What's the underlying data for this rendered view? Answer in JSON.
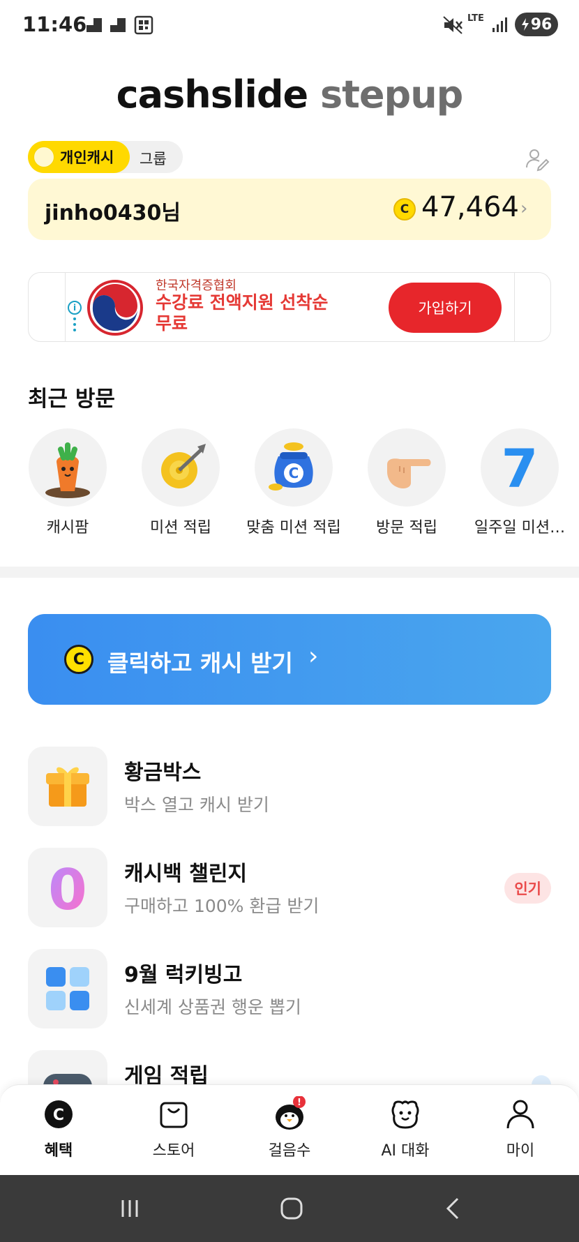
{
  "status_bar": {
    "time": "11:46",
    "battery": "96",
    "network": "LTE"
  },
  "logo": {
    "part1": "cashslide",
    "part2": "stepup"
  },
  "toggle": {
    "active_label": "개인캐시",
    "inactive_label": "그룹"
  },
  "cash_card": {
    "username": "jinho0430님",
    "coin_symbol": "C",
    "balance": "47,464"
  },
  "ad": {
    "org": "한국자격증협회",
    "headline": "수강료 전액지원 선착순 무료",
    "cta": "가입하기",
    "info_symbol": "i"
  },
  "recent": {
    "title": "최근 방문",
    "items": [
      {
        "label": "캐시팜",
        "icon": "carrot-icon"
      },
      {
        "label": "미션 적립",
        "icon": "target-icon"
      },
      {
        "label": "맞춤 미션 적립",
        "icon": "coin-bag-icon"
      },
      {
        "label": "방문 적립",
        "icon": "pointing-hand-icon"
      },
      {
        "label": "일주일 미션…",
        "icon": "seven-icon"
      }
    ],
    "seven_glyph": "7",
    "bag_glyph": "C"
  },
  "click_banner": {
    "coin": "C",
    "label": "클릭하고 캐시 받기",
    "chevron": "›"
  },
  "list": [
    {
      "title": "황금박스",
      "subtitle": "박스 열고 캐시 받기",
      "icon": "gift-box-icon",
      "badge": ""
    },
    {
      "title": "캐시백 챌린지",
      "subtitle": "구매하고 100% 환급 받기",
      "icon": "zero-icon",
      "badge": "인기"
    },
    {
      "title": "9월 럭키빙고",
      "subtitle": "신세계 상품권 행운 뽑기",
      "icon": "bingo-grid-icon",
      "badge": ""
    },
    {
      "title": "게임 적립",
      "subtitle": "",
      "icon": "gamepad-icon",
      "badge": ""
    }
  ],
  "list_glyphs": {
    "zero": "0"
  },
  "bottom_nav": {
    "items": [
      {
        "label": "혜택",
        "icon": "coin-c-icon",
        "active": true
      },
      {
        "label": "스토어",
        "icon": "shopping-bag-icon",
        "active": false
      },
      {
        "label": "걸음수",
        "icon": "penguin-icon",
        "active": false
      },
      {
        "label": "AI 대화",
        "icon": "ai-face-icon",
        "active": false
      },
      {
        "label": "마이",
        "icon": "person-icon",
        "active": false
      }
    ],
    "coin_glyph": "C",
    "alert_glyph": "!"
  },
  "colors": {
    "brand_yellow": "#ffd900",
    "banner_blue": "#3a8ef0",
    "ad_red": "#e7262b",
    "hot_badge": "#ea4a4a"
  }
}
